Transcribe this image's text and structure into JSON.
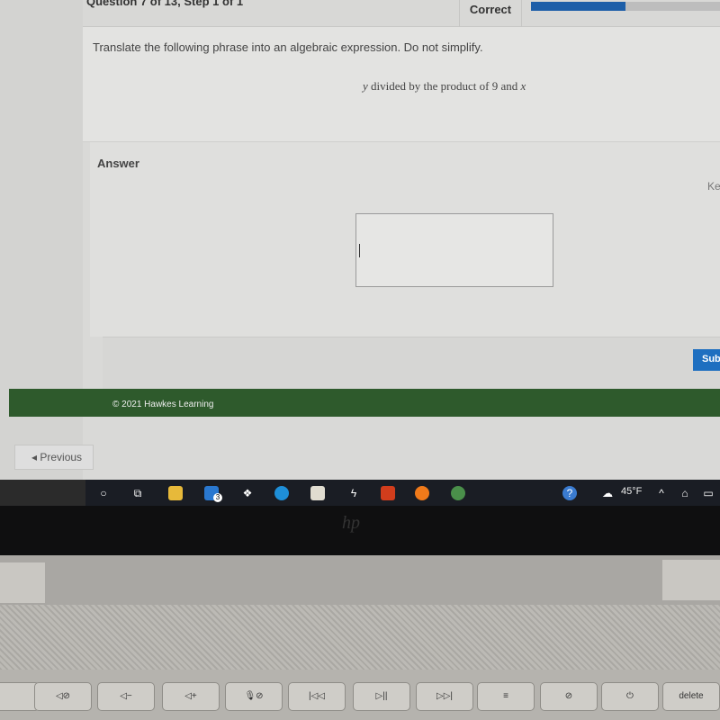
{
  "header": {
    "question_title": "Question 7 of 13, Step 1 of 1",
    "status": "Correct",
    "progress_percent": 50,
    "progress_color": "#1d5ea8"
  },
  "question": {
    "instruction": "Translate the following phrase into an algebraic expression. Do not simplify.",
    "phrase_var1": "y",
    "phrase_text": " divided by the product of 9 and ",
    "phrase_var2": "x"
  },
  "answer": {
    "label": "Answer",
    "keypad_partial": "Ke",
    "input_value": ""
  },
  "submit_label": "Sub",
  "footer": {
    "copyright": "© 2021 Hawkes Learning"
  },
  "nav": {
    "previous_label": "◂ Previous"
  },
  "taskbar": {
    "icons": [
      "search-icon",
      "task-view-icon",
      "file-explorer-icon",
      "mail-icon",
      "dropbox-icon",
      "edge-icon",
      "store-icon",
      "app-icon",
      "office-icon",
      "firefox-icon",
      "chrome-icon"
    ],
    "mail_badge": "3",
    "weather": "45°F"
  },
  "laptop": {
    "logo": "hp",
    "keys": [
      "f5 mute",
      "f6 vol-",
      "f7 vol+",
      "f8 mic",
      "f9 prev",
      "f10 play",
      "f11 next",
      "f12 menu",
      "airplane",
      "power",
      "delete"
    ],
    "delete_label": "delete"
  }
}
